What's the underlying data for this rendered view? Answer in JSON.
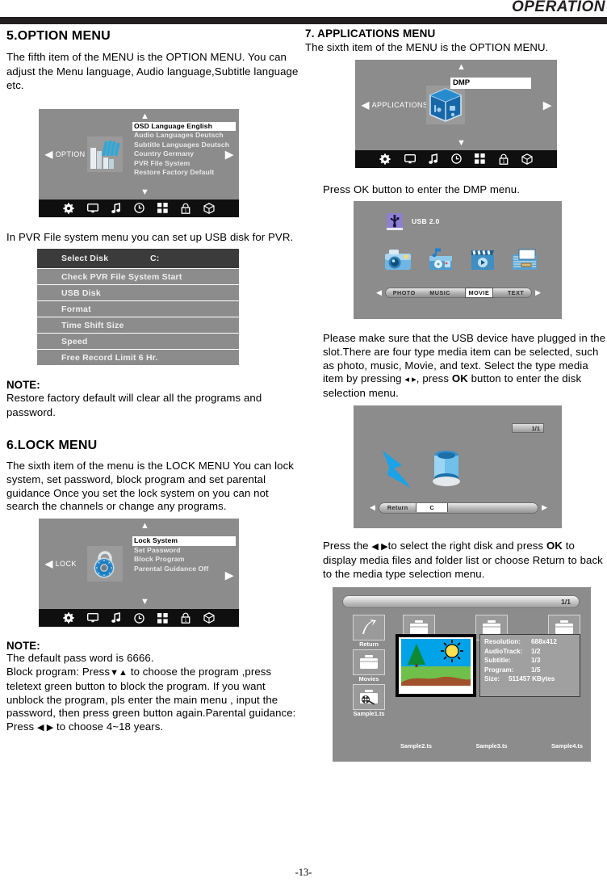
{
  "header": {
    "title": "OPERATION"
  },
  "page_number": "-13-",
  "left": {
    "section5": {
      "heading": "5.OPTION MENU",
      "intro": "The fifth item of the MENU is the OPTION MENU. You can adjust the Menu language, Audio language,Subtitle language etc.",
      "osd": {
        "side_label": "OPTION",
        "left_caret": "◀",
        "right_caret": "▶",
        "up_arrow": "▲",
        "down_arrow": "▼",
        "items": [
          "OSD Language English",
          "Audio Languages Deutsch",
          "Subtitle Languages Deutsch",
          "Country Germany",
          "PVR File System",
          "Restore Factory Default"
        ],
        "selected_index": 0
      },
      "pvr_intro": "In PVR File system menu you can set up USB disk for PVR.",
      "pvr_table": {
        "header_label": "Select Disk",
        "header_value": "C:",
        "rows": [
          "Check PVR File System Start",
          "USB Disk",
          "Format",
          "Time Shift Size",
          "Speed",
          "Free Record Limit 6 Hr."
        ]
      },
      "note_title": "NOTE:",
      "note_body": "Restore factory default will clear all the programs and password."
    },
    "section6": {
      "heading": "6.LOCK MENU",
      "intro": "The sixth item of the menu is the LOCK MENU You can lock system, set password, block program and set parental  guidance Once you set the lock system on you can not search the channels or change  any programs.",
      "osd": {
        "side_label": "LOCK",
        "left_caret": "◀",
        "right_caret": "▶",
        "up_arrow": "▲",
        "down_arrow": "▼",
        "items": [
          "Lock System",
          "Set Password",
          "Block Program",
          "Parental Guidance Off"
        ],
        "selected_index": 0
      },
      "note_title": "NOTE:",
      "note_line1": "The default pass word is 6666.",
      "note_line2": "Block program: Press",
      "note_line2b": "to choose the program ,press teletext green button to block the program.  If you want unblock the program, pls enter the main menu , input the password, then press green button again.Parental guidance: Press",
      "note_line2c": "to choose  4~18 years.",
      "dn_up_glyph": "▼▲",
      "lr_glyph": "◀ ▶"
    }
  },
  "right": {
    "section7": {
      "heading": "7. APPLICATIONS MENU",
      "intro": "The sixth item of the MENU is the OPTION MENU.",
      "osd": {
        "side_label": "APPLICATIONS",
        "left_caret": "◀",
        "right_caret": "▶",
        "up_arrow": "▲",
        "down_arrow": "▼",
        "selected_item": "DMP"
      },
      "press_ok": "Press OK button to enter the DMP menu.",
      "usb_screen": {
        "device_label": "USB 2.0",
        "types": [
          "PHOTO",
          "MUSIC",
          "MOVIE",
          "TEXT"
        ],
        "selected_type": "MOVIE",
        "left_arrow": "◀",
        "right_arrow": "▶"
      },
      "usb_para_a": "Please make sure that the USB device have plugged in the slot.There are four type media item can be selected, such as photo, music, Movie, and text. Select the type media item by pressing",
      "usb_para_arrows": "◂ ▸",
      "usb_para_b": ", press",
      "usb_para_ok": "OK",
      "usb_para_c": "button to enter the disk selection menu.",
      "disk_screen": {
        "page_indicator": "1/1",
        "items": [
          "Return",
          "C"
        ],
        "selected_item": "C",
        "left_arrow": "◀",
        "right_arrow": "▶"
      },
      "disk_para_a": "Press the",
      "disk_para_arrows": "◀ ▶",
      "disk_para_b": "to select the right disk and press",
      "disk_para_ok": "OK",
      "disk_para_c": "to display media files and folder list or choose Return to back to the media type selection menu.",
      "file_browser": {
        "page_indicator": "1/1",
        "left_column": [
          "Return",
          "Movies",
          "Sample1.ts"
        ],
        "file_captions": [
          "Sample2.ts",
          "Sample3.ts",
          "Sample4.ts"
        ],
        "info": [
          {
            "key": "Resolution:",
            "value": "688x412"
          },
          {
            "key": "AudioTrack:",
            "value": "1/2"
          },
          {
            "key": "Subtitle:",
            "value": "1/3"
          },
          {
            "key": "Program:",
            "value": "1/5"
          },
          {
            "key": "Size:",
            "value": "511457 KBytes"
          }
        ]
      }
    }
  },
  "colors": {
    "osd_bg": "#8c8c8c",
    "osd_bar": "#100f10",
    "table_row": "#8c8c8c",
    "table_head": "#3b3b3b",
    "ink": "#231f20"
  }
}
